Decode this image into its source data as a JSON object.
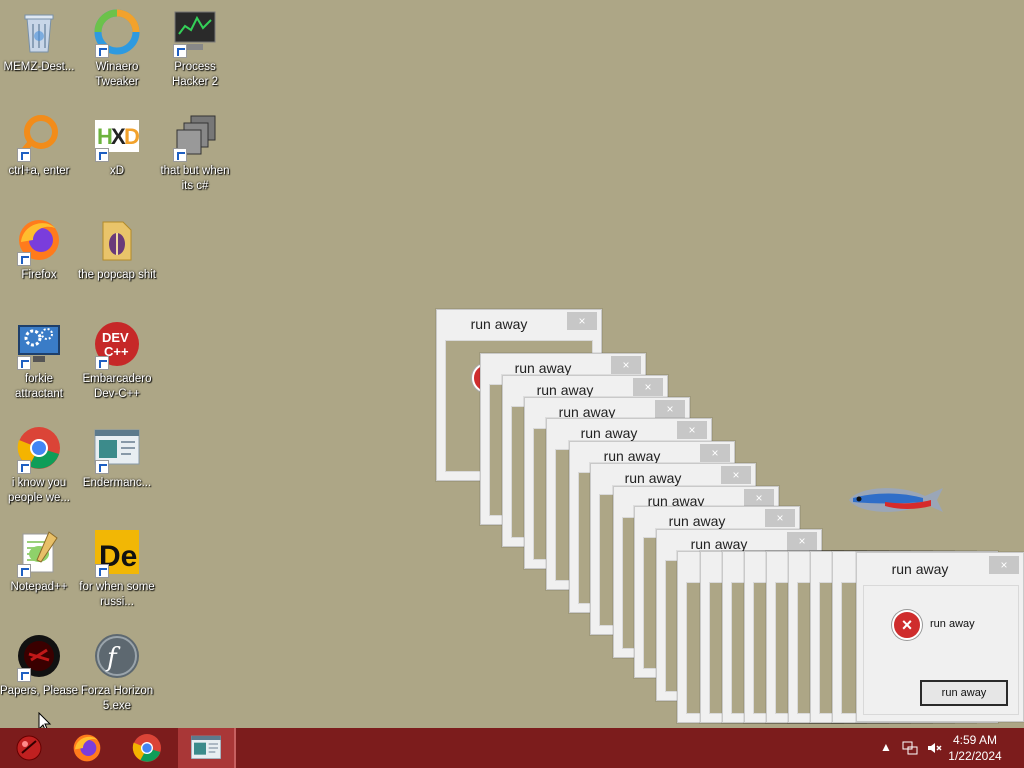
{
  "desktop": {
    "icons": [
      {
        "label": "MEMZ-Dest...",
        "icon": "recycle-bin-icon"
      },
      {
        "label": "Winaero Tweaker",
        "icon": "winaero-icon"
      },
      {
        "label": "Process Hacker 2",
        "icon": "process-hacker-icon"
      },
      {
        "label": "ctrl+a, enter",
        "icon": "magnifier-icon"
      },
      {
        "label": "xD",
        "icon": "hxd-icon"
      },
      {
        "label": "that but when its c#",
        "icon": "stacked-windows-icon"
      },
      {
        "label": "Firefox",
        "icon": "firefox-icon"
      },
      {
        "label": "the popcap shit",
        "icon": "folder-icon"
      },
      {
        "label": "forkie attractant",
        "icon": "settings-monitor-icon"
      },
      {
        "label": "Embarcadero Dev-C++",
        "icon": "devcpp-icon"
      },
      {
        "label": "i know you people we...",
        "icon": "chrome-icon"
      },
      {
        "label": "Endermanc...",
        "icon": "window-app-icon"
      },
      {
        "label": "Notepad++",
        "icon": "notepadpp-icon"
      },
      {
        "label": "for when some russi...",
        "icon": "de-icon"
      },
      {
        "label": "Papers, Please",
        "icon": "papers-please-icon"
      },
      {
        "label": "Forza Horizon 5.exe",
        "icon": "flash-icon"
      }
    ]
  },
  "dialogs": {
    "title": "run away",
    "message": "run away",
    "button_label": "run away",
    "close_glyph": "×"
  },
  "taskbar": {
    "items": [
      "start-orb-icon",
      "firefox-icon",
      "chrome-icon",
      "window-app-icon"
    ],
    "clock_time": "4:59 AM",
    "clock_date": "1/22/2024"
  },
  "colors": {
    "desktop": "#ada686",
    "taskbar": "#7c1c1c",
    "error_red": "#cf2d2d"
  }
}
